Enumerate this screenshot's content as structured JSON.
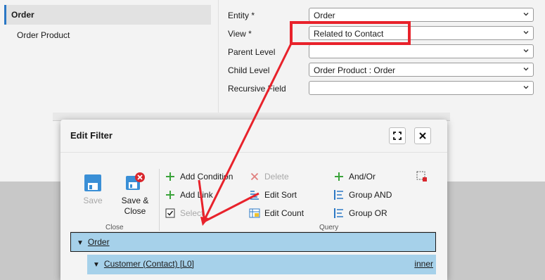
{
  "sidebar": {
    "items": [
      {
        "label": "Order"
      },
      {
        "label": "Order Product"
      }
    ]
  },
  "form": {
    "entity": {
      "label": "Entity *",
      "value": "Order"
    },
    "view": {
      "label": "View *",
      "value": "Related to Contact"
    },
    "parent_level": {
      "label": "Parent Level",
      "value": ""
    },
    "child_level": {
      "label": "Child Level",
      "value": "Order Product : Order"
    },
    "recursive_field": {
      "label": "Recursive Field",
      "value": ""
    }
  },
  "modal": {
    "title": "Edit Filter",
    "ribbon": {
      "close_group": {
        "label": "Close",
        "save": "Save",
        "save_close_line1": "Save &",
        "save_close_line2": "Close"
      },
      "query_group": {
        "label": "Query",
        "add_condition": "Add Condition",
        "add_link": "Add Link",
        "select": "Select",
        "delete": "Delete",
        "edit_sort": "Edit Sort",
        "edit_count": "Edit Count",
        "and_or": "And/Or",
        "group_and": "Group AND",
        "group_or": "Group OR"
      }
    },
    "tree": {
      "root": "Order",
      "child": "Customer (Contact) [L0]",
      "join": "inner"
    }
  },
  "colors": {
    "annotation_red": "#e8222b",
    "accent_blue": "#2b78c5",
    "tree_highlight": "#a6d1ea",
    "add_green": "#3aa33a"
  }
}
